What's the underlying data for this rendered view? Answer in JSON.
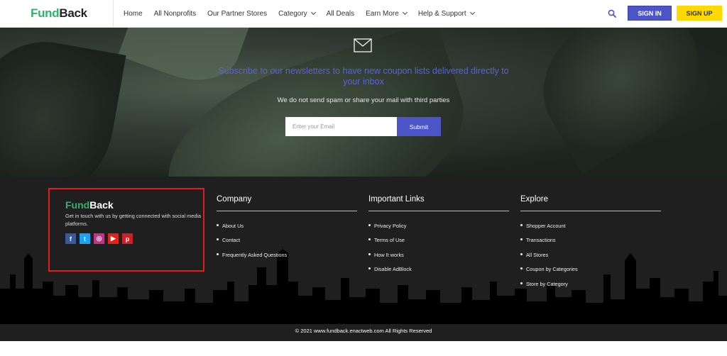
{
  "header": {
    "logo_green": "Fund",
    "logo_dark": "Back",
    "nav": [
      {
        "label": "Home",
        "dropdown": false
      },
      {
        "label": "All Nonprofits",
        "dropdown": false
      },
      {
        "label": "Our Partner Stores",
        "dropdown": false
      },
      {
        "label": "Category",
        "dropdown": true
      },
      {
        "label": "All Deals",
        "dropdown": false
      },
      {
        "label": "Earn More",
        "dropdown": true
      },
      {
        "label": "Help & Support",
        "dropdown": true
      }
    ],
    "search_icon": "search-icon",
    "sign_in": "SIGN IN",
    "sign_up": "SIGN UP"
  },
  "hero": {
    "icon": "envelope-icon",
    "title": "Subscribe to our newsletters to have new coupon lists delivered directly to your inbox",
    "subtitle": "We do not send spam or share your mail with third parties",
    "email_placeholder": "Enter your Email",
    "submit_label": "Submit"
  },
  "footer": {
    "logo_green": "Fund",
    "logo_dark": "Back",
    "description": "Get in touch with us by getting connected with social media platforms.",
    "socials": [
      {
        "name": "facebook-icon",
        "glyph": "f",
        "color": "#3b5998"
      },
      {
        "name": "twitter-icon",
        "glyph": "t",
        "color": "#1da1f2"
      },
      {
        "name": "instagram-icon",
        "glyph": "◎",
        "color": "#c13584"
      },
      {
        "name": "youtube-icon",
        "glyph": "▶",
        "color": "#e62117"
      },
      {
        "name": "pinterest-icon",
        "glyph": "p",
        "color": "#cb2027"
      }
    ],
    "columns": [
      {
        "title": "Company",
        "links": [
          "About Us",
          "Contact",
          "Frequently Asked Questions"
        ]
      },
      {
        "title": "Important Links",
        "links": [
          "Privacy Policy",
          "Terms of Use",
          "How It works",
          "Disable AdBlock"
        ]
      },
      {
        "title": "Explore",
        "links": [
          "Shopper Account",
          "Transactions",
          "All Stores",
          "Coupon by Categories",
          "Store by Category"
        ]
      }
    ],
    "copyright": "© 2021 www.fundback.enactweb.com All Rights Reserved"
  },
  "colors": {
    "brand_green": "#2fb36b",
    "accent_blue": "#4b55c8",
    "signup_yellow": "#ffd900",
    "highlight_red": "#e01c1c"
  }
}
